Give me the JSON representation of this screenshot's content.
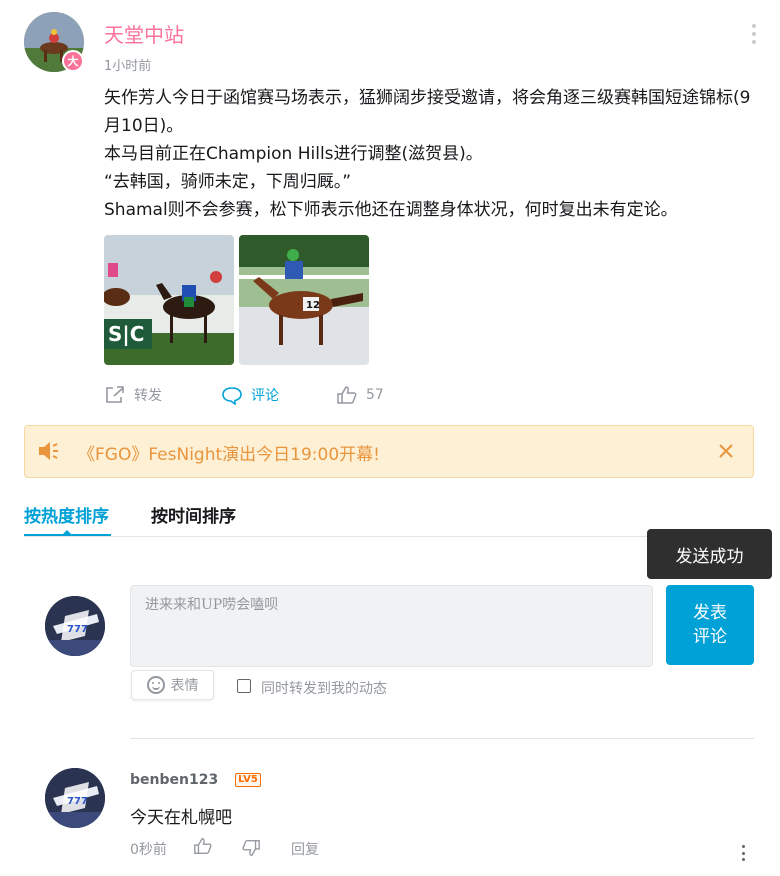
{
  "post": {
    "author": "天堂中站",
    "author_badge": "大",
    "time": "1小时前",
    "paragraphs": [
      "矢作芳人今日于函馆赛马场表示，猛狮阔步接受邀请，将会角逐三级赛韩国短途锦标(9月10日)。",
      "本马目前正在Champion Hills进行调整(滋贺县)。",
      "“去韩国，骑师未定，下周归厩。”",
      "Shamal则不会参赛，松下师表示他还在调整身体状况，何时复出未有定论。"
    ],
    "actions": {
      "share_label": "转发",
      "comment_label": "评论",
      "like_count": "57"
    }
  },
  "notice": {
    "text": "《FGO》FesNight演出今日19:00开幕!",
    "accent": "#e8953e"
  },
  "tabs": [
    {
      "label": "按热度排序",
      "active": true
    },
    {
      "label": "按时间排序",
      "active": false
    }
  ],
  "toast": "发送成功",
  "comment_box": {
    "placeholder": "进来来和UP唠会嗑呗",
    "send_line1": "发表",
    "send_line2": "评论",
    "emoji_label": "表情",
    "repost_label": "同时转发到我的动态"
  },
  "comments": [
    {
      "user": "benben123",
      "level": "LV5",
      "text": "今天在札幌吧",
      "time": "0秒前",
      "reply_label": "回复"
    }
  ],
  "colors": {
    "brand_pink": "#fb7299",
    "accent_blue": "#00a1d6",
    "notice_bg": "#fdf0d5"
  }
}
